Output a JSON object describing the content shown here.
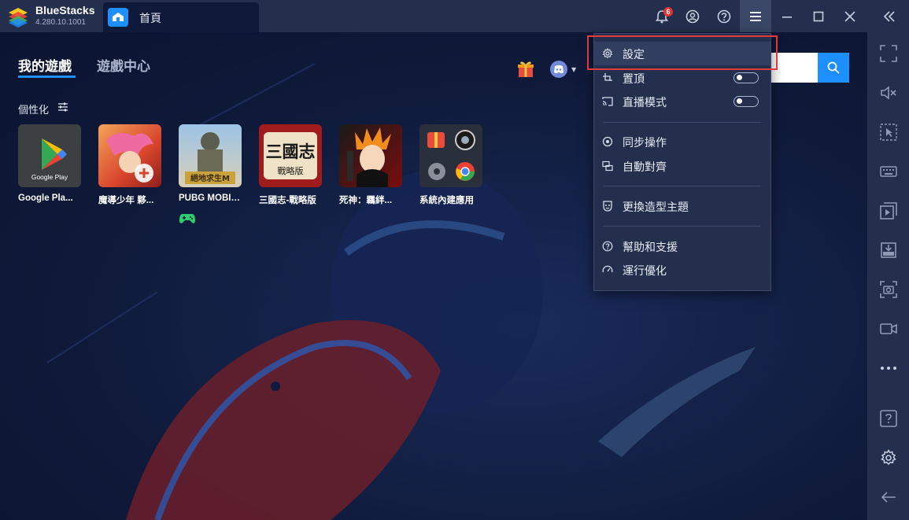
{
  "titlebar": {
    "app_name": "BlueStacks",
    "version": "4.280.10.1001",
    "home_tab_label": "首頁",
    "notification_count": "6"
  },
  "tabs": [
    {
      "label": "我的遊戲",
      "active": true
    },
    {
      "label": "遊戲中心",
      "active": false
    }
  ],
  "personalize_label": "個性化",
  "apps": [
    {
      "label": "Google Pla...",
      "icon_text": "Google Play"
    },
    {
      "label": "魔導少年 夥..."
    },
    {
      "label": "PUBG MOBILE",
      "icon_text": "絕地求生M"
    },
    {
      "label": "三國志-戰略版",
      "icon_text": "三國志",
      "icon_subtext": "戰略版"
    },
    {
      "label": "死神：羈絆..."
    },
    {
      "label": "系統內建應用"
    }
  ],
  "menu": {
    "items": [
      {
        "label": "設定",
        "icon": "gear-icon"
      },
      {
        "label": "置頂",
        "icon": "pin-icon",
        "toggle": "off"
      },
      {
        "label": "直播模式",
        "icon": "cast-icon",
        "toggle": "off"
      },
      {
        "label": "同步操作",
        "icon": "sync-icon"
      },
      {
        "label": "自動對齊",
        "icon": "align-icon"
      },
      {
        "label": "更換造型主題",
        "icon": "theme-icon"
      },
      {
        "label": "幫助和支援",
        "icon": "help-icon"
      },
      {
        "label": "運行優化",
        "icon": "speed-icon"
      }
    ]
  },
  "colors": {
    "accent": "#1e8fff",
    "titlebar": "#232f4d",
    "background": "#0f1a3a",
    "highlight_box": "#e03a3a"
  }
}
